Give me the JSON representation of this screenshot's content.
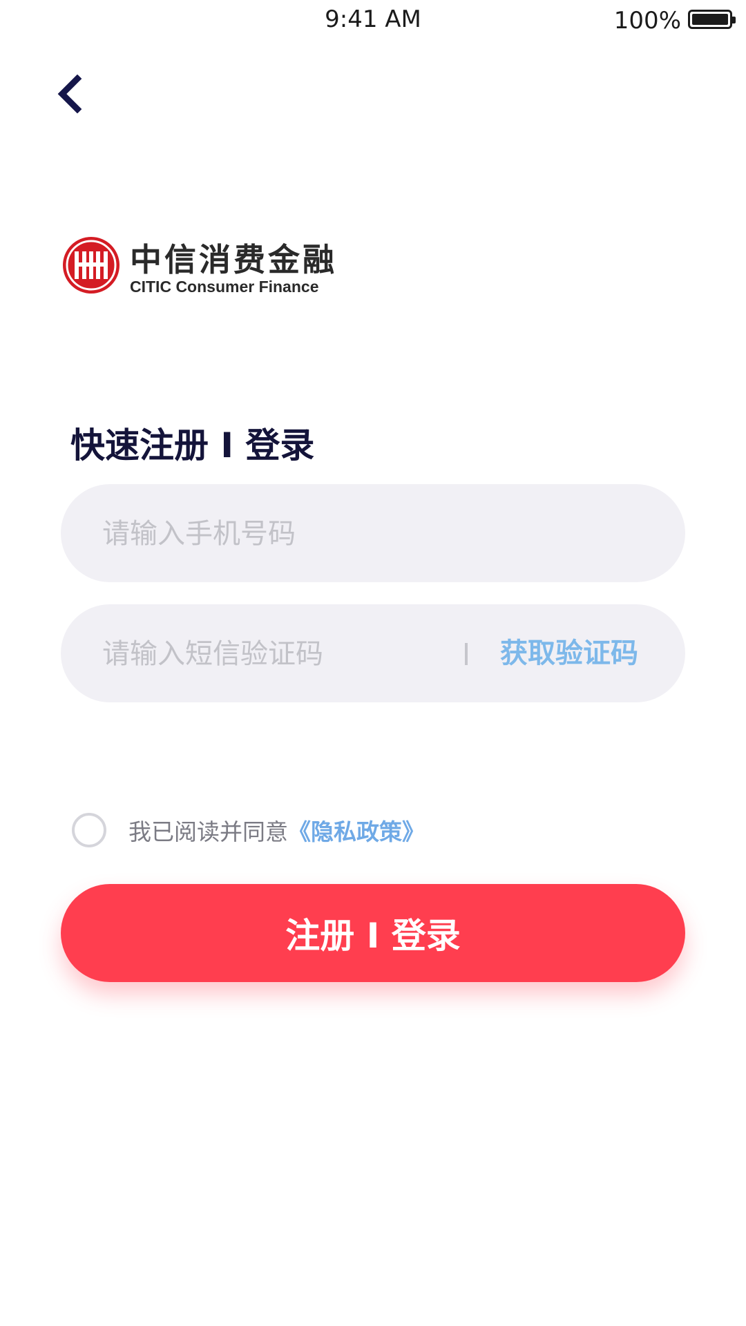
{
  "status_bar": {
    "time": "9:41 AM",
    "battery_percent": "100%",
    "battery_level": 1.0
  },
  "header": {
    "back_icon": "chevron-left-icon"
  },
  "logo": {
    "name_cn": "中信消费金融",
    "name_en": "CITIC Consumer Finance",
    "seal_icon": "citic-seal-icon",
    "brand_color": "#d41c24"
  },
  "form": {
    "title": "快速注册 I 登录",
    "phone": {
      "value": "",
      "placeholder": "请输入手机号码"
    },
    "sms_code": {
      "value": "",
      "placeholder": "请输入短信验证码",
      "get_code_label": "获取验证码"
    },
    "agreement": {
      "checked": false,
      "prefix": "我已阅读并同意",
      "link_label": "《隐私政策》"
    },
    "submit_label": "注册 I 登录"
  },
  "colors": {
    "primary": "#ff3e4f",
    "link": "#7db8ea",
    "title": "#14143a",
    "input_bg": "#f1f0f5",
    "placeholder": "#c2c2c8"
  }
}
